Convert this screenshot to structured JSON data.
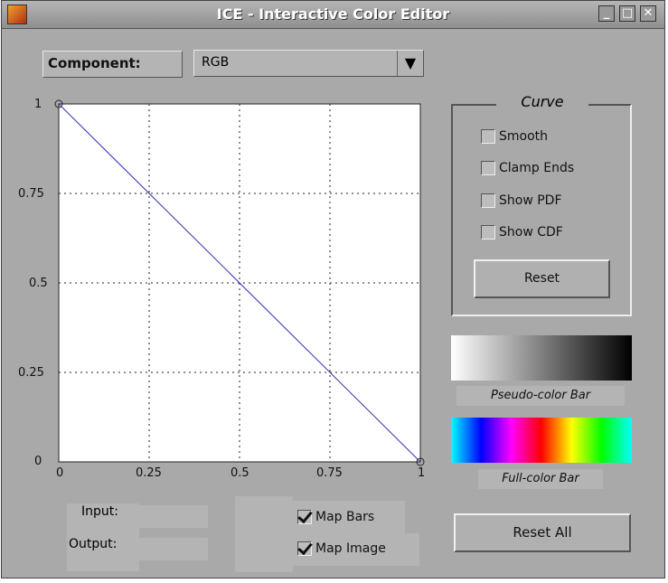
{
  "window": {
    "title": "ICE - Interactive Color Editor"
  },
  "component": {
    "label": "Component:",
    "selected": "RGB"
  },
  "plot": {
    "x_ticks": [
      "0",
      "0.25",
      "0.5",
      "0.75",
      "1"
    ],
    "y_ticks": [
      "1",
      "0.75",
      "0.5",
      "0.25",
      "0"
    ],
    "curve_color": "#3030b0"
  },
  "curve_panel": {
    "title": "Curve",
    "options": [
      {
        "label": "Smooth",
        "checked": false
      },
      {
        "label": "Clamp Ends",
        "checked": false
      },
      {
        "label": "Show PDF",
        "checked": false
      },
      {
        "label": "Show CDF",
        "checked": false
      }
    ],
    "reset_label": "Reset"
  },
  "pseudo_bar": {
    "label": "Pseudo-color Bar"
  },
  "full_bar": {
    "label": "Full-color Bar"
  },
  "io": {
    "input_label": "Input:",
    "output_label": "Output:",
    "input_value": "",
    "output_value": ""
  },
  "map": {
    "bars_label": "Map Bars",
    "bars_checked": true,
    "image_label": "Map Image",
    "image_checked": true
  },
  "reset_all_label": "Reset All"
}
